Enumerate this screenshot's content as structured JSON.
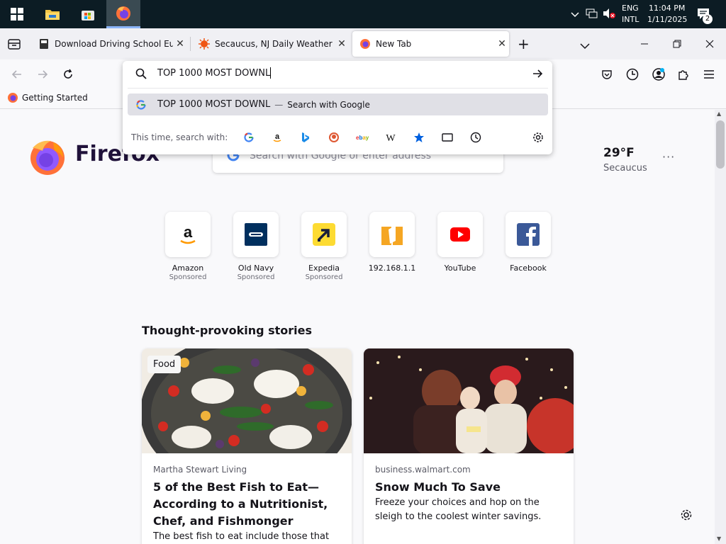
{
  "taskbar": {
    "language": "ENG",
    "layout": "INTL",
    "time": "11:04 PM",
    "date": "1/11/2025",
    "notification_count": "2",
    "icons": [
      "windows-start-icon",
      "file-explorer-icon",
      "microsoft-store-icon",
      "firefox-icon",
      "chevron-up-icon",
      "network-icon",
      "volume-muted-icon",
      "notification-center-icon"
    ]
  },
  "tabs": [
    {
      "title": "Download Driving School Europe",
      "favicon": "document-favicon",
      "active": false
    },
    {
      "title": "Secaucus, NJ Daily Weather | Ac",
      "favicon": "accuweather-favicon",
      "active": false
    },
    {
      "title": "New Tab",
      "favicon": "firefox-favicon",
      "active": true
    }
  ],
  "bookmarks": {
    "item": "Getting Started"
  },
  "urlbar": {
    "query": "TOP 1000 MOST DOWNL",
    "suggestion": "TOP 1000 MOST DOWNL",
    "suggestion_sep": "—",
    "suggestion_action": "Search with Google",
    "search_with_label": "This time, search with:",
    "engines": [
      "google",
      "amazon",
      "bing",
      "duckduckgo",
      "ebay",
      "wikipedia",
      "bookmarks",
      "tabs",
      "history"
    ]
  },
  "newtab": {
    "brand": "Firefox",
    "search_placeholder": "Search with Google or enter address",
    "weather": {
      "temp": "29°F",
      "location": "Secaucus",
      "menu": "···"
    },
    "top_sites": [
      {
        "name": "Amazon",
        "sponsored": "Sponsored"
      },
      {
        "name": "Old Navy",
        "sponsored": "Sponsored"
      },
      {
        "name": "Expedia",
        "sponsored": "Sponsored"
      },
      {
        "name": "192.168.1.1",
        "sponsored": ""
      },
      {
        "name": "YouTube",
        "sponsored": ""
      },
      {
        "name": "Facebook",
        "sponsored": ""
      }
    ],
    "stories_heading": "Thought-provoking stories",
    "stories": [
      {
        "tag": "Food",
        "source": "Martha Stewart Living",
        "headline": "5 of the Best Fish to Eat—According to a Nutritionist, Chef, and Fishmonger",
        "excerpt": "The best fish to eat include those that are"
      },
      {
        "tag": "",
        "source": "business.walmart.com",
        "headline": "Snow Much To Save",
        "excerpt": "Freeze your choices and hop on the sleigh to the coolest winter savings."
      }
    ]
  },
  "colors": {
    "taskbar": "#0c1c24",
    "accent": "#0060df",
    "firefox_orange": "#ff7139"
  }
}
